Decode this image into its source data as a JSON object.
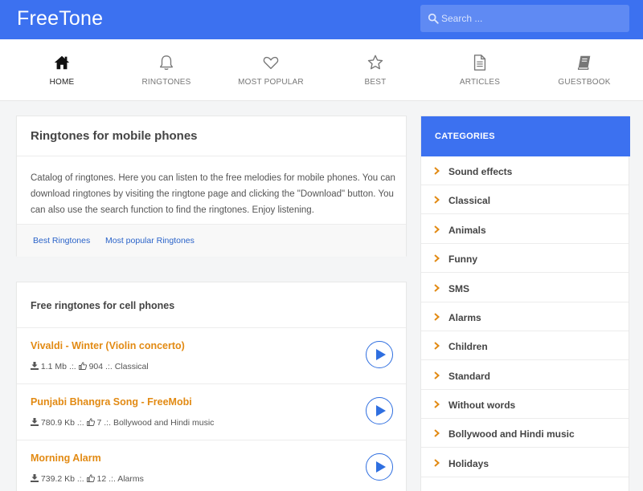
{
  "header": {
    "logo": "FreeTone",
    "search_placeholder": "Search ..."
  },
  "nav": [
    {
      "label": "HOME",
      "icon": "home-icon",
      "active": true
    },
    {
      "label": "RINGTONES",
      "icon": "bell-icon"
    },
    {
      "label": "MOST POPULAR",
      "icon": "heart-icon"
    },
    {
      "label": "BEST",
      "icon": "star-icon"
    },
    {
      "label": "ARTICLES",
      "icon": "document-icon"
    },
    {
      "label": "GUESTBOOK",
      "icon": "book-icon"
    }
  ],
  "intro": {
    "title": "Ringtones for mobile phones",
    "description": "Catalog of ringtones. Here you can listen to the free melodies for mobile phones. You can download ringtones by visiting the ringtone page and clicking the \"Download\" button. You can also use the search function to find the ringtones. Enjoy listening.",
    "link_best": "Best Ringtones",
    "link_popular": "Most popular Ringtones"
  },
  "ringtones": {
    "title": "Free ringtones for cell phones",
    "separator": ".:.",
    "items": [
      {
        "name": "Vivaldi - Winter (Violin concerto)",
        "size": "1.1 Mb",
        "likes": "904",
        "category": "Classical"
      },
      {
        "name": "Punjabi Bhangra Song - FreeMobi",
        "size": "780.9 Kb",
        "likes": "7",
        "category": "Bollywood and Hindi music"
      },
      {
        "name": "Morning Alarm",
        "size": "739.2 Kb",
        "likes": "12",
        "category": "Alarms"
      }
    ]
  },
  "categories": {
    "title": "CATEGORIES",
    "items": [
      "Sound effects",
      "Classical",
      "Animals",
      "Funny",
      "SMS",
      "Alarms",
      "Children",
      "Standard",
      "Without words",
      "Bollywood and Hindi music",
      "Holidays"
    ]
  },
  "colors": {
    "brand_blue": "#3c71f0",
    "title_orange": "#e28a13",
    "link_blue": "#2a63c9"
  }
}
